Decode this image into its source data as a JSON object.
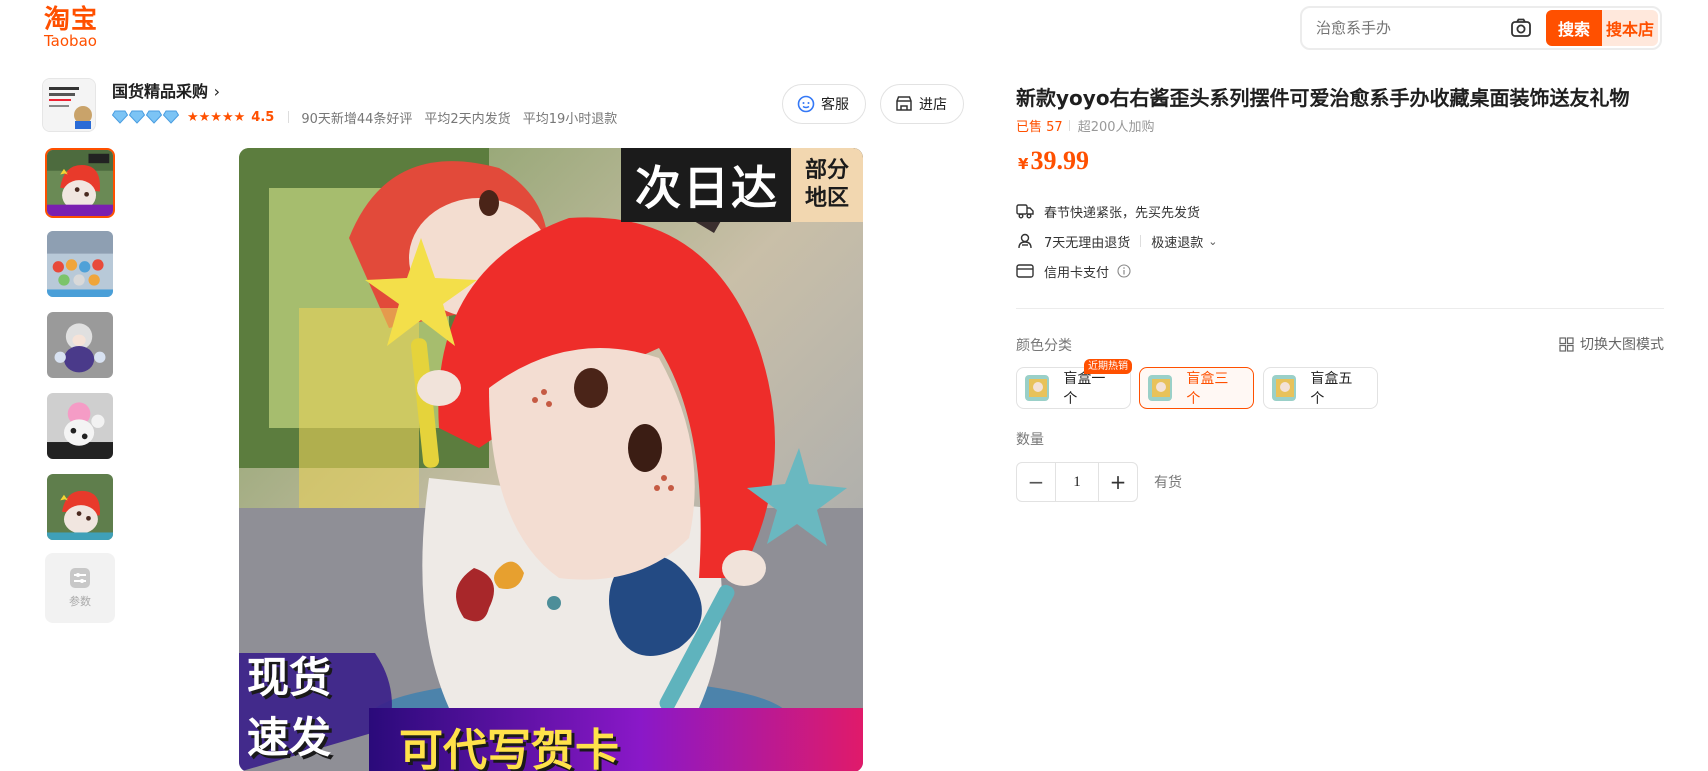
{
  "header": {
    "logo_cn": "淘宝",
    "logo_en": "Taobao",
    "search_placeholder": "治愈系手办",
    "search_button": "搜索",
    "search_shop_button": "搜本店"
  },
  "shop": {
    "name": "国货精品采购",
    "rating": "4.5",
    "stats": [
      "90天新增44条好评",
      "平均2天内发货",
      "平均19小时退款"
    ],
    "service_button": "客服",
    "enter_shop_button": "进店"
  },
  "gallery": {
    "params_label": "参数",
    "overlay_top_main": "次日达",
    "overlay_top_side": "部分\n地区",
    "overlay_bottom_left": "现货\n速发",
    "overlay_bottom_right": "可代写贺卡"
  },
  "product": {
    "title": "新款yoyo右右酱歪头系列摆件可爱治愈系手办收藏桌面装饰送友礼物",
    "sold_label": "已售 57",
    "added_to_cart": "超200人加购",
    "currency": "¥",
    "price": "39.99",
    "services": {
      "shipping": "春节快递紧张，先买先发货",
      "returns": "7天无理由退货",
      "fast_refund": "极速退款",
      "payment": "信用卡支付"
    },
    "color_label": "颜色分类",
    "switch_mode": "切换大图模式",
    "skus": [
      {
        "label": "盲盒一个",
        "badge": "近期热销"
      },
      {
        "label": "盲盒三个"
      },
      {
        "label": "盲盒五个"
      }
    ],
    "quantity_label": "数量",
    "quantity": "1",
    "stock_status": "有货"
  },
  "colors": {
    "accent": "#ff5000",
    "accent_light": "#ffe8dc"
  }
}
